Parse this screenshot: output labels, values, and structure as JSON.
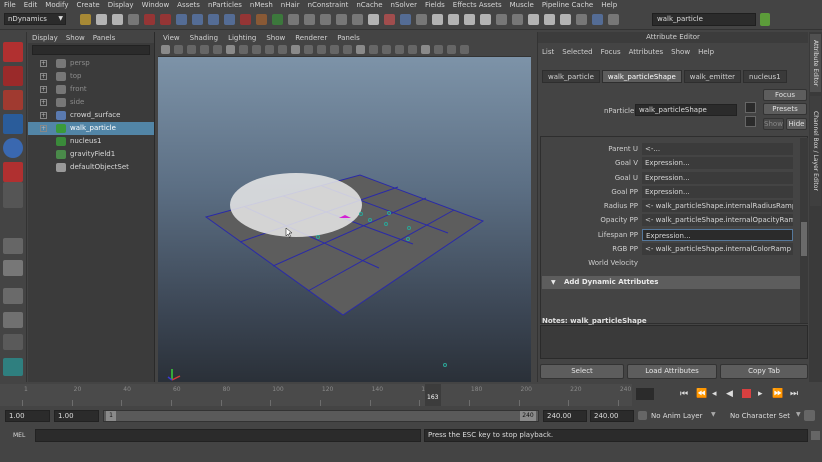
{
  "menubar": {
    "items": [
      "File",
      "Edit",
      "Modify",
      "Create",
      "Display",
      "Window",
      "Assets",
      "nParticles",
      "nMesh",
      "nHair",
      "nConstraint",
      "nCache",
      "nSolver",
      "Fields",
      "Effects Assets",
      "Muscle",
      "Pipeline Cache",
      "Help"
    ]
  },
  "status_line": {
    "mode": "nDynamics",
    "search_value": "walk_particle"
  },
  "outliner": {
    "menu": [
      "Display",
      "Show",
      "Panels"
    ],
    "items": [
      {
        "label": "persp",
        "dim": true,
        "expand": "+"
      },
      {
        "label": "top",
        "dim": true,
        "expand": "+"
      },
      {
        "label": "front",
        "dim": true,
        "expand": "+"
      },
      {
        "label": "side",
        "dim": true,
        "expand": "+"
      },
      {
        "label": "crowd_surface",
        "dim": false,
        "expand": "+"
      },
      {
        "label": "walk_particle",
        "dim": false,
        "expand": "+",
        "selected": true
      },
      {
        "label": "nucleus1",
        "dim": false,
        "expand": ""
      },
      {
        "label": "gravityField1",
        "dim": false,
        "expand": ""
      },
      {
        "label": "defaultObjectSet",
        "dim": false,
        "expand": ""
      }
    ]
  },
  "viewport": {
    "menu": [
      "View",
      "Shading",
      "Lighting",
      "Show",
      "Renderer",
      "Panels"
    ]
  },
  "attribute_editor": {
    "title": "Attribute Editor",
    "menu": [
      "List",
      "Selected",
      "Focus",
      "Attributes",
      "Show",
      "Help"
    ],
    "tabs": [
      "walk_particle",
      "walk_particleShape",
      "walk_emitter",
      "nucleus1"
    ],
    "active_tab": 1,
    "nparticle_label": "nParticle:",
    "nparticle_value": "walk_particleShape",
    "buttons": {
      "focus": "Focus",
      "presets": "Presets",
      "show": "Show",
      "hide": "Hide"
    },
    "rows": [
      {
        "label": "Parent U",
        "value": "<-..."
      },
      {
        "label": "Goal V",
        "value": "Expression..."
      },
      {
        "label": "Goal U",
        "value": "Expression..."
      },
      {
        "label": "Goal PP",
        "value": "Expression..."
      },
      {
        "label": "Radius PP",
        "value": "<- walk_particleShape.internalRadiusRamp"
      },
      {
        "label": "Opacity PP",
        "value": "<- walk_particleShape.internalOpacityRamp"
      },
      {
        "label": "Lifespan PP",
        "value": "Expression...",
        "highlight": true
      },
      {
        "label": "RGB PP",
        "value": "<- walk_particleShape.internalColorRamp"
      },
      {
        "label": "World Velocity",
        "value": ""
      }
    ],
    "dynamic_header": "Add Dynamic Attributes",
    "notes_label": "Notes: walk_particleShape",
    "bottom_buttons": [
      "Select",
      "Load Attributes",
      "Copy Tab"
    ]
  },
  "side_tabs": [
    "Attribute Editor",
    "Channel Box / Layer Editor"
  ],
  "time_slider": {
    "ticks": [
      "1",
      "20",
      "40",
      "60",
      "80",
      "100",
      "120",
      "140",
      "160",
      "180",
      "200",
      "220",
      "240"
    ],
    "current_frame": "163"
  },
  "range": {
    "start": "1.00",
    "playback_start": "1.00",
    "slider_start": "1",
    "slider_end": "240",
    "playback_end": "240.00",
    "end": "240.00",
    "anim_layer": "No Anim Layer",
    "char_set": "No Character Set"
  },
  "command_line": {
    "language": "MEL",
    "feedback": "Press the ESC key to stop playback."
  },
  "colors": {
    "selection": "#5285a6",
    "grid_line": "#2a2aa8",
    "particle": "#2ba597",
    "grid_plane": "#5d5d5d"
  }
}
